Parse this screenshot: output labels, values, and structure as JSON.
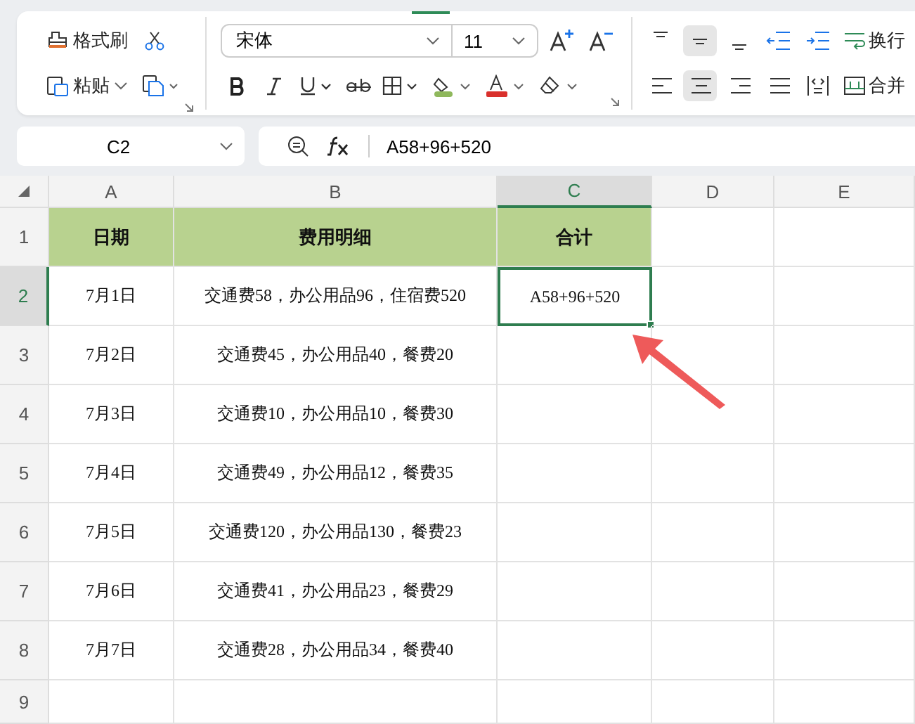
{
  "toolbar": {
    "clipboard": {
      "format_painter": "格式刷",
      "paste": "粘贴"
    },
    "font": {
      "name": "宋体",
      "size": "11"
    },
    "vertical_align": [
      {
        "selected": false
      },
      {
        "selected": true
      },
      {
        "selected": false
      }
    ],
    "horizontal_align": [
      {
        "selected": false
      },
      {
        "selected": true
      },
      {
        "selected": false
      },
      {
        "selected": false
      }
    ],
    "wrap": "换行",
    "merge": "合并"
  },
  "name_box": "C2",
  "formula": "A58+96+520",
  "columns": [
    {
      "label": "A",
      "selected": false
    },
    {
      "label": "B",
      "selected": false
    },
    {
      "label": "C",
      "selected": true
    },
    {
      "label": "D",
      "selected": false
    },
    {
      "label": "E",
      "selected": false
    }
  ],
  "header_row": {
    "label": "1",
    "selected": false,
    "cells": [
      "日期",
      "费用明细",
      "合计"
    ]
  },
  "rows": [
    {
      "label": "2",
      "selected": true,
      "cells": [
        "7月1日",
        "交通费58，办公用品96，住宿费520",
        "A58+96+520"
      ]
    },
    {
      "label": "3",
      "selected": false,
      "cells": [
        "7月2日",
        "交通费45，办公用品40，餐费20"
      ]
    },
    {
      "label": "4",
      "selected": false,
      "cells": [
        "7月3日",
        "交通费10，办公用品10，餐费30"
      ]
    },
    {
      "label": "5",
      "selected": false,
      "cells": [
        "7月4日",
        "交通费49，办公用品12，餐费35"
      ]
    },
    {
      "label": "6",
      "selected": false,
      "cells": [
        "7月5日",
        "交通费120，办公用品130，餐费23"
      ]
    },
    {
      "label": "7",
      "selected": false,
      "cells": [
        "7月6日",
        "交通费41，办公用品23，餐费29"
      ]
    },
    {
      "label": "8",
      "selected": false,
      "cells": [
        "7月7日",
        "交通费28，办公用品34，餐费40"
      ]
    },
    {
      "label": "9",
      "selected": false,
      "cells": []
    }
  ]
}
